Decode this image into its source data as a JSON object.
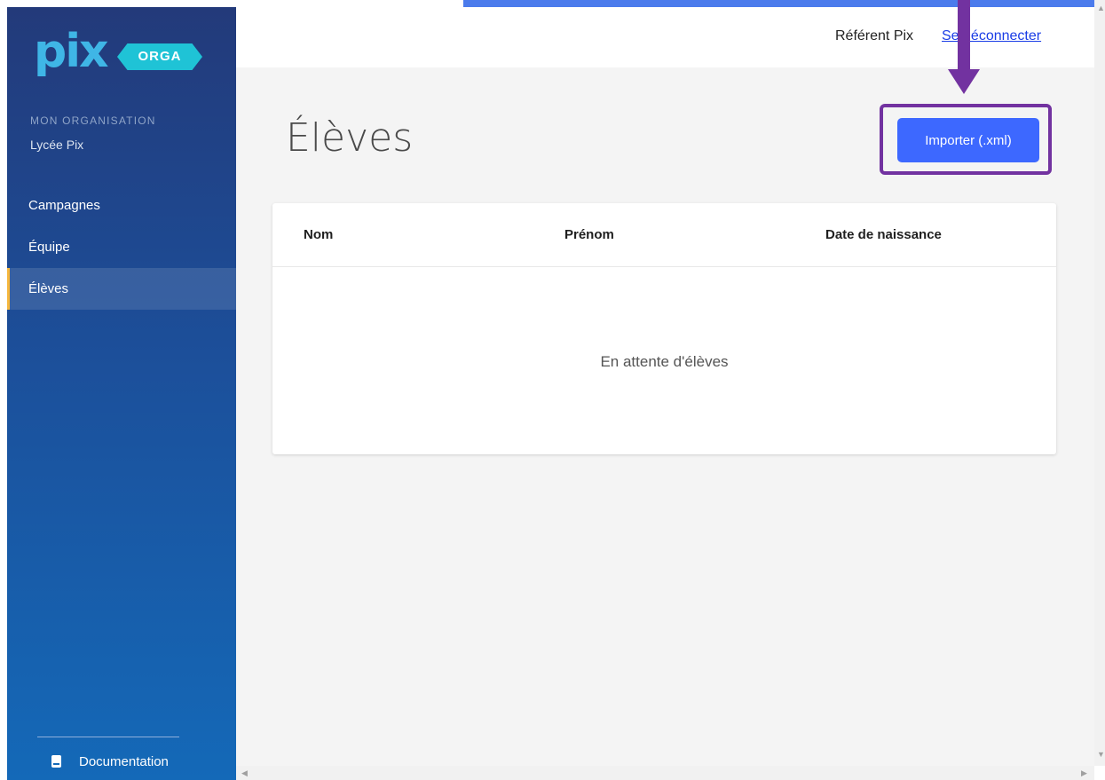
{
  "app": {
    "logo_text": "pix",
    "logo_badge": "ORGA"
  },
  "sidebar": {
    "org_label": "MON ORGANISATION",
    "org_name": "Lycée Pix",
    "items": [
      {
        "label": "Campagnes",
        "active": false
      },
      {
        "label": "Équipe",
        "active": false
      },
      {
        "label": "Élèves",
        "active": true
      }
    ],
    "documentation_label": "Documentation"
  },
  "header": {
    "user_name": "Référent Pix",
    "logout_label": "Se déconnecter"
  },
  "main": {
    "title": "Élèves",
    "import_button_label": "Importer (.xml)",
    "table": {
      "columns": [
        "Nom",
        "Prénom",
        "Date de naissance"
      ],
      "empty_message": "En attente d'élèves"
    }
  },
  "colors": {
    "sidebar_top": "#233a7a",
    "sidebar_bottom": "#1469b8",
    "accent": "#3d68ff",
    "annotation": "#7232a0",
    "active_indicator": "#f6b73c"
  },
  "icons": {
    "documentation": "book-icon",
    "annotation_arrow": "arrow-down-icon"
  }
}
